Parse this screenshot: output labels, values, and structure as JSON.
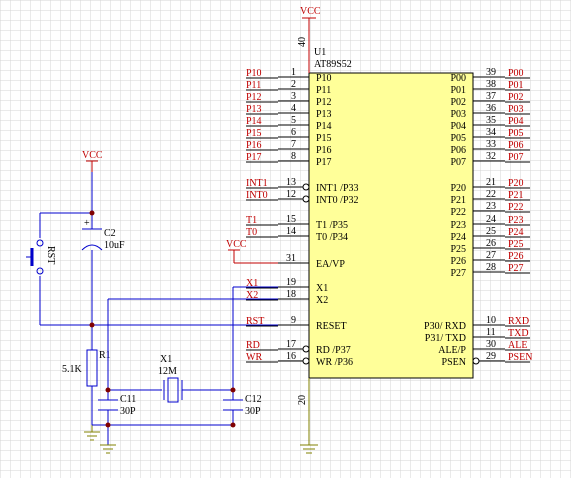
{
  "chip": {
    "ref": "U1",
    "part": "AT89S52",
    "vcc_pin": "40",
    "vcc_label": "VCC",
    "gnd_pin": "20",
    "left_pins": [
      {
        "num": "1",
        "name": "P10",
        "net": "P10"
      },
      {
        "num": "2",
        "name": "P11",
        "net": "P11"
      },
      {
        "num": "3",
        "name": "P12",
        "net": "P12"
      },
      {
        "num": "4",
        "name": "P13",
        "net": "P13"
      },
      {
        "num": "5",
        "name": "P14",
        "net": "P14"
      },
      {
        "num": "6",
        "name": "P15",
        "net": "P15"
      },
      {
        "num": "7",
        "name": "P16",
        "net": "P16"
      },
      {
        "num": "8",
        "name": "P17",
        "net": "P17"
      },
      {
        "num": "13",
        "name": "INT1 /P33",
        "net": "INT1",
        "bubble": true
      },
      {
        "num": "12",
        "name": "INT0 /P32",
        "net": "INT0",
        "bubble": true
      },
      {
        "num": "15",
        "name": "T1 /P35",
        "net": "T1"
      },
      {
        "num": "14",
        "name": "T0 /P34",
        "net": "T0"
      },
      {
        "num": "31",
        "name": "EA/VP",
        "net": ""
      },
      {
        "num": "19",
        "name": "X1",
        "net": "X1"
      },
      {
        "num": "18",
        "name": "X2",
        "net": "X2"
      },
      {
        "num": "9",
        "name": "RESET",
        "net": "RST"
      },
      {
        "num": "17",
        "name": "RD /P37",
        "net": "RD",
        "bubble": true
      },
      {
        "num": "16",
        "name": "WR /P36",
        "net": "WR",
        "bubble": true
      }
    ],
    "right_pins": [
      {
        "num": "39",
        "name": "P00",
        "net": "P00"
      },
      {
        "num": "38",
        "name": "P01",
        "net": "P01"
      },
      {
        "num": "37",
        "name": "P02",
        "net": "P02"
      },
      {
        "num": "36",
        "name": "P03",
        "net": "P03"
      },
      {
        "num": "35",
        "name": "P04",
        "net": "P04"
      },
      {
        "num": "34",
        "name": "P05",
        "net": "P05"
      },
      {
        "num": "33",
        "name": "P06",
        "net": "P06"
      },
      {
        "num": "32",
        "name": "P07",
        "net": "P07"
      },
      {
        "num": "21",
        "name": "P20",
        "net": "P20"
      },
      {
        "num": "22",
        "name": "P21",
        "net": "P21"
      },
      {
        "num": "23",
        "name": "P22",
        "net": "P22"
      },
      {
        "num": "24",
        "name": "P23",
        "net": "P23"
      },
      {
        "num": "25",
        "name": "P24",
        "net": "P24"
      },
      {
        "num": "26",
        "name": "P25",
        "net": "P25"
      },
      {
        "num": "27",
        "name": "P26",
        "net": "P26"
      },
      {
        "num": "28",
        "name": "P27",
        "net": "P27"
      },
      {
        "num": "10",
        "name": "P30/ RXD",
        "net": "RXD"
      },
      {
        "num": "11",
        "name": "P31/ TXD",
        "net": "TXD"
      },
      {
        "num": "30",
        "name": "ALE/P",
        "net": "ALE"
      },
      {
        "num": "29",
        "name": "PSEN",
        "net": "PSEN",
        "bubble": true
      }
    ]
  },
  "power": {
    "vcc_top": "VCC",
    "vcc_reset": "VCC",
    "vcc_ea": "VCC"
  },
  "components": {
    "c2": {
      "ref": "C2",
      "value": "10uF"
    },
    "r1": {
      "ref": "R1",
      "value": "5.1K"
    },
    "x1": {
      "ref": "X1",
      "value": "12M"
    },
    "c11": {
      "ref": "C11",
      "value": "30P"
    },
    "c12": {
      "ref": "C12",
      "value": "30P"
    },
    "switch": {
      "ref": "RST"
    }
  },
  "colors": {
    "wire": "#0000cc",
    "net_label": "#c00000",
    "power": "#c00000",
    "body": "#ffff99",
    "grid": "#d4d4d4",
    "ground": "#808000"
  }
}
